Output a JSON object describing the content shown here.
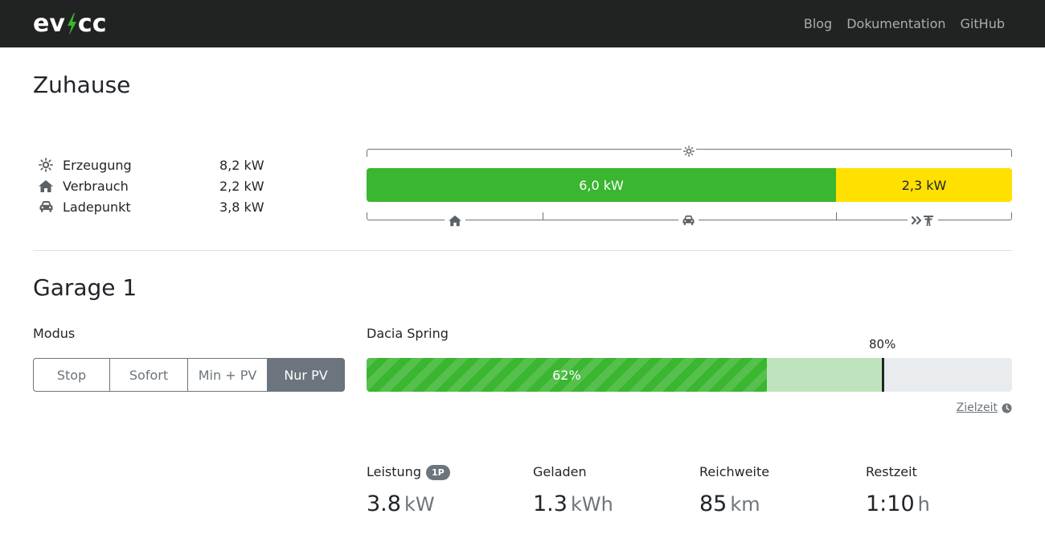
{
  "nav": {
    "logo_left": "ev",
    "logo_right": "cc",
    "links": [
      "Blog",
      "Dokumentation",
      "GitHub"
    ]
  },
  "site": {
    "title": "Zuhause",
    "items": [
      {
        "icon": "sun-icon",
        "label": "Erzeugung",
        "value": "8,2 kW"
      },
      {
        "icon": "home-icon",
        "label": "Verbrauch",
        "value": "2,2 kW"
      },
      {
        "icon": "car-icon",
        "label": "Ladepunkt",
        "value": "3,8 kW"
      }
    ],
    "flow_bar": {
      "self_consumption_label": "6,0 kW",
      "export_label": "2,3 kW",
      "self_consumption_fraction": 0.727
    }
  },
  "loadpoint": {
    "title": "Garage 1",
    "mode_label": "Modus",
    "modes": [
      "Stop",
      "Sofort",
      "Min + PV",
      "Nur PV"
    ],
    "active_mode": "Nur PV",
    "vehicle_title": "Dacia Spring",
    "soc_percent": 62,
    "soc_label": "62%",
    "target_soc_percent": 80,
    "target_soc_label": "80%",
    "target_time_label": "Zielzeit",
    "stats": [
      {
        "label": "Leistung",
        "badge": "1P",
        "value": "3.8",
        "unit": "kW"
      },
      {
        "label": "Geladen",
        "value": "1.3",
        "unit": "kWh"
      },
      {
        "label": "Reichweite",
        "value": "85",
        "unit": "km"
      },
      {
        "label": "Restzeit",
        "value": "1:10",
        "unit": "h"
      }
    ]
  },
  "colors": {
    "navbar": "#212222",
    "green": "#3ab630",
    "yellow": "#ffe000",
    "plan": "#bfe4bd",
    "muted": "#6c757d"
  }
}
